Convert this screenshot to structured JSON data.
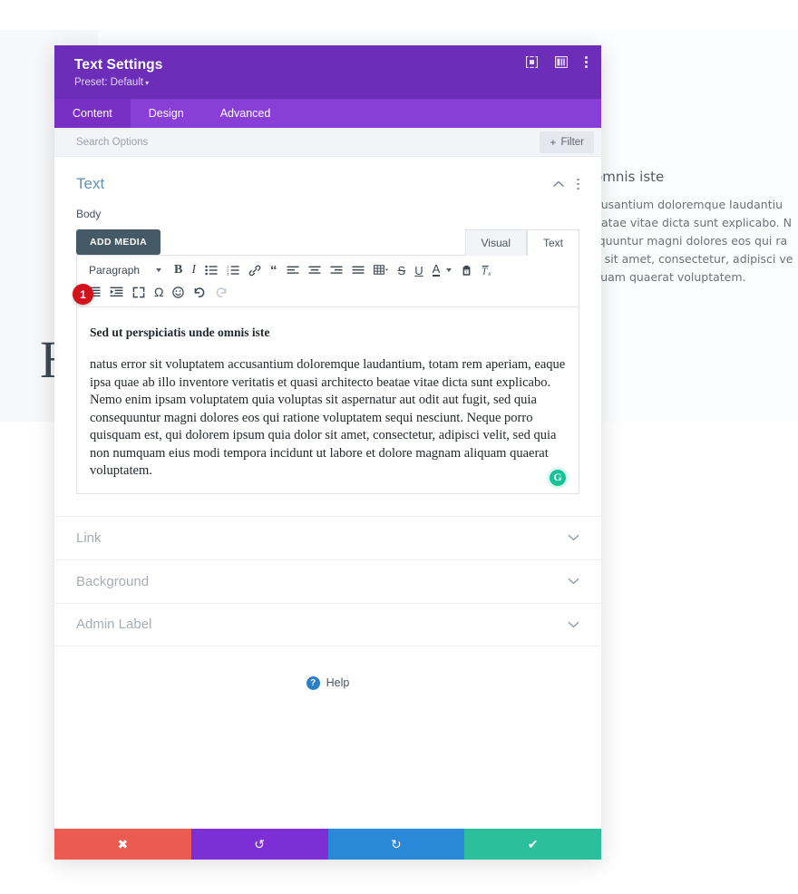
{
  "background_page": {
    "heading_letter": "H",
    "partial_title": "s unde omnis iste",
    "partial_lines": [
      "tatem accusantium doloremque laudantiu",
      "hitecto beatae vitae dicta sunt explicabo. N",
      "uia consequuntur magni dolores eos qui ra",
      "quia dolor sit amet, consectetur, adipisci ve",
      "gnam aliquam quaerat voluptatem."
    ]
  },
  "modal": {
    "title": "Text Settings",
    "preset_label": "Preset: Default",
    "header_icons": [
      {
        "name": "focus-icon",
        "label": "focus"
      },
      {
        "name": "layout-panel-icon",
        "label": "layout"
      },
      {
        "name": "more-vertical-icon",
        "label": "more"
      }
    ],
    "tabs": [
      {
        "label": "Content",
        "active": true
      },
      {
        "label": "Design",
        "active": false
      },
      {
        "label": "Advanced",
        "active": false
      }
    ],
    "search": {
      "placeholder": "Search Options",
      "value": ""
    },
    "filter_button": {
      "label": "Filter",
      "plus": "+"
    },
    "section": {
      "title": "Text",
      "field_label": "Body",
      "add_media_label": "ADD MEDIA",
      "editor_tabs": [
        {
          "label": "Visual",
          "active": false
        },
        {
          "label": "Text",
          "active": true
        }
      ],
      "format_select": "Paragraph",
      "toolbar_row1": [
        "bold-icon",
        "italic-icon",
        "bulleted-list-icon",
        "numbered-list-icon",
        "link-icon",
        "blockquote-icon",
        "align-left-icon",
        "align-center-icon",
        "align-right-icon",
        "align-justify-icon",
        "table-icon",
        "strikethrough-icon",
        "underline-icon",
        "text-color-icon",
        "paste-as-text-icon",
        "clear-formatting-icon"
      ],
      "toolbar_row2": [
        "outdent-icon",
        "indent-icon",
        "fullscreen-icon",
        "special-character-icon",
        "emoji-icon",
        "undo-icon",
        "redo-icon"
      ],
      "content_heading": "Sed ut perspiciatis unde omnis iste",
      "content_paragraph": "natus error sit voluptatem accusantium doloremque laudantium, totam rem aperiam, eaque ipsa quae ab illo inventore veritatis et quasi architecto beatae vitae dicta sunt explicabo. Nemo enim ipsam voluptatem quia voluptas sit aspernatur aut odit aut fugit, sed quia consequuntur magni dolores eos qui ratione voluptatem sequi nesciunt. Neque porro quisquam est, qui dolorem ipsum quia dolor sit amet, consectetur, adipisci velit, sed quia non numquam eius modi tempora incidunt ut labore et dolore magnam aliquam quaerat voluptatem.",
      "grammarly_badge": "G"
    },
    "accordions": [
      {
        "label": "Link"
      },
      {
        "label": "Background"
      },
      {
        "label": "Admin Label"
      }
    ],
    "help": {
      "icon": "?",
      "label": "Help"
    },
    "footer_actions": [
      {
        "name": "cancel",
        "glyph": "✖",
        "color": "#eb5b52"
      },
      {
        "name": "undo",
        "glyph": "↺",
        "color": "#7b2fd4"
      },
      {
        "name": "redo",
        "glyph": "↻",
        "color": "#2b87d8"
      },
      {
        "name": "save",
        "glyph": "✔",
        "color": "#2bbf9b"
      }
    ]
  },
  "annotation": {
    "step_number": "1"
  }
}
